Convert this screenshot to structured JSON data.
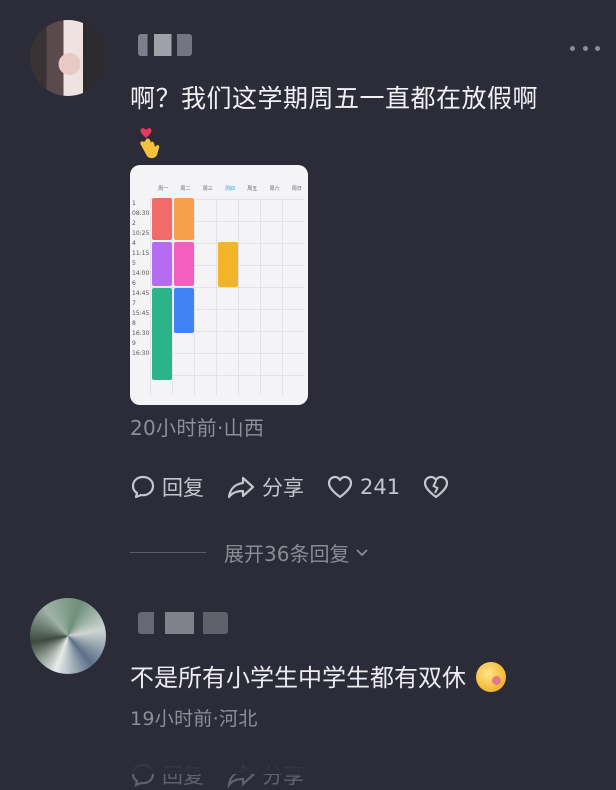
{
  "comment1": {
    "text": "啊？我们这学期周五一直都在放假啊",
    "meta": "20小时前·山西",
    "actions": {
      "reply_label": "回复",
      "share_label": "分享",
      "like_count": "241"
    },
    "expand_label": "展开36条回复"
  },
  "schedule": {
    "days": [
      "周一",
      "周二",
      "周三",
      "周四",
      "周五",
      "周六",
      "周日"
    ],
    "times": [
      "1",
      "08:30",
      "2",
      "10:25",
      "4",
      "11:15",
      "5",
      "14:00",
      "6",
      "14:45",
      "7",
      "15:45",
      "8",
      "16:30",
      "9",
      "16:30"
    ],
    "course_colors": [
      "#f26b6b",
      "#f7a04b",
      "#b46df0",
      "#f25fbf",
      "#f4b42a",
      "#2db38a",
      "#3f83f5"
    ]
  },
  "comment2": {
    "text": "不是所有小学生中学生都有双休",
    "meta": "19小时前·河北"
  },
  "icons": {
    "more": "more-icon",
    "reply": "chat-bubble-icon",
    "share": "share-arrow-icon",
    "like": "heart-icon",
    "dislike": "broken-heart-icon",
    "expand": "chevron-down-icon"
  }
}
